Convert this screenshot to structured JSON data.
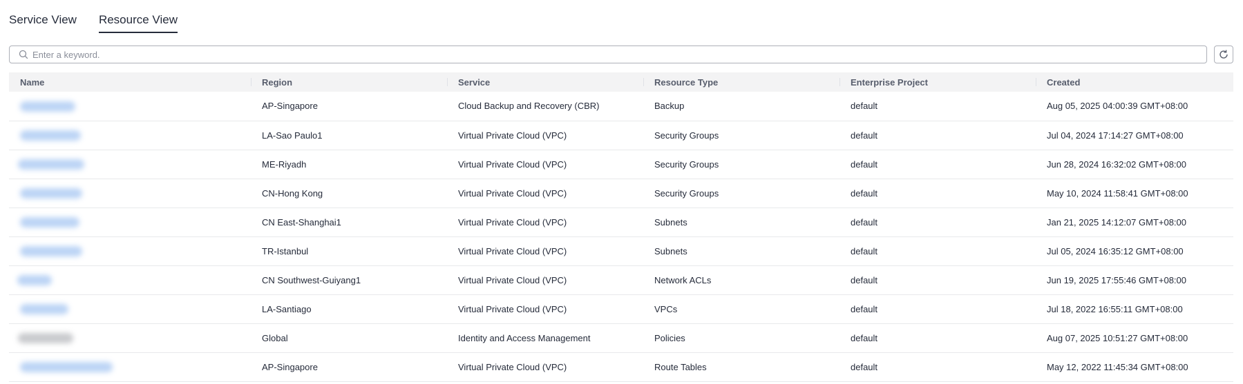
{
  "tabs": [
    {
      "label": "Service View",
      "active": false
    },
    {
      "label": "Resource View",
      "active": true
    }
  ],
  "search": {
    "placeholder": "Enter a keyword.",
    "value": ""
  },
  "table": {
    "columns": [
      "Name",
      "Region",
      "Service",
      "Resource Type",
      "Enterprise Project",
      "Created"
    ],
    "rows": [
      {
        "name": "",
        "region": "AP-Singapore",
        "service": "Cloud Backup and Recovery (CBR)",
        "resource_type": "Backup",
        "project": "default",
        "created": "Aug 05, 2025 04:00:39 GMT+08:00"
      },
      {
        "name": "",
        "region": "LA-Sao Paulo1",
        "service": "Virtual Private Cloud (VPC)",
        "resource_type": "Security Groups",
        "project": "default",
        "created": "Jul 04, 2024 17:14:27 GMT+08:00"
      },
      {
        "name": "",
        "region": "ME-Riyadh",
        "service": "Virtual Private Cloud (VPC)",
        "resource_type": "Security Groups",
        "project": "default",
        "created": "Jun 28, 2024 16:32:02 GMT+08:00"
      },
      {
        "name": "",
        "region": "CN-Hong Kong",
        "service": "Virtual Private Cloud (VPC)",
        "resource_type": "Security Groups",
        "project": "default",
        "created": "May 10, 2024 11:58:41 GMT+08:00"
      },
      {
        "name": "",
        "region": "CN East-Shanghai1",
        "service": "Virtual Private Cloud (VPC)",
        "resource_type": "Subnets",
        "project": "default",
        "created": "Jan 21, 2025 14:12:07 GMT+08:00"
      },
      {
        "name": "",
        "region": "TR-Istanbul",
        "service": "Virtual Private Cloud (VPC)",
        "resource_type": "Subnets",
        "project": "default",
        "created": "Jul 05, 2024 16:35:12 GMT+08:00"
      },
      {
        "name": "",
        "region": "CN Southwest-Guiyang1",
        "service": "Virtual Private Cloud (VPC)",
        "resource_type": "Network ACLs",
        "project": "default",
        "created": "Jun 19, 2025 17:55:46 GMT+08:00"
      },
      {
        "name": "",
        "region": "LA-Santiago",
        "service": "Virtual Private Cloud (VPC)",
        "resource_type": "VPCs",
        "project": "default",
        "created": "Jul 18, 2022 16:55:11 GMT+08:00"
      },
      {
        "name": "",
        "region": "Global",
        "service": "Identity and Access Management",
        "resource_type": "Policies",
        "project": "default",
        "created": "Aug 07, 2025 10:51:27 GMT+08:00"
      },
      {
        "name": "",
        "region": "AP-Singapore",
        "service": "Virtual Private Cloud (VPC)",
        "resource_type": "Route Tables",
        "project": "default",
        "created": "May 12, 2022 11:45:34 GMT+08:00"
      }
    ]
  },
  "icons": {
    "search": "search-icon",
    "refresh": "refresh-icon"
  }
}
